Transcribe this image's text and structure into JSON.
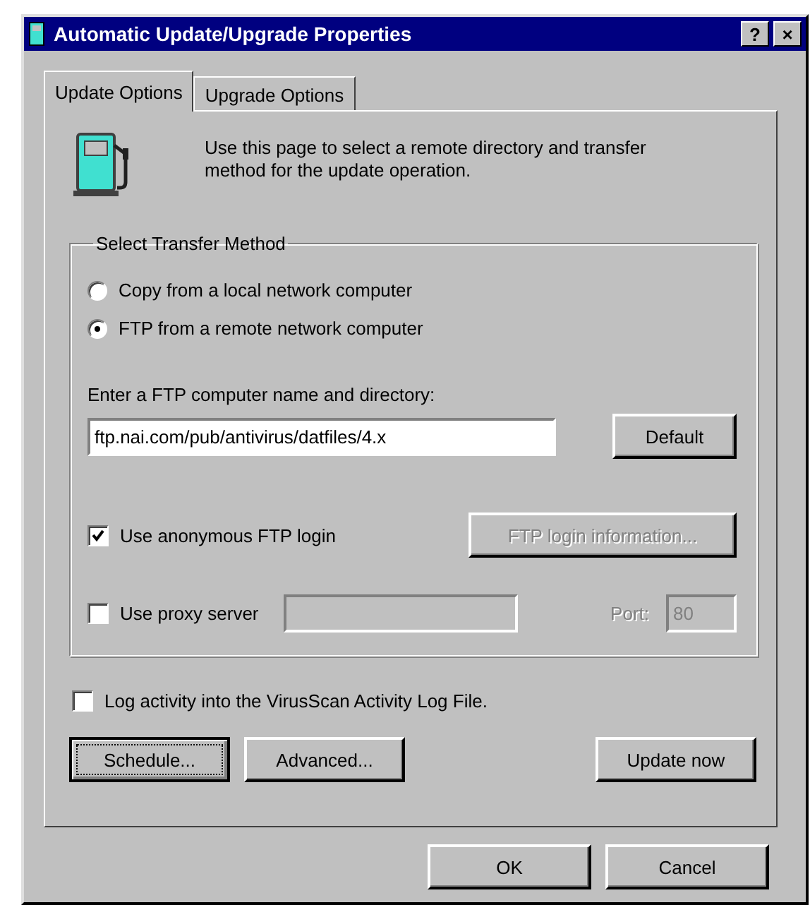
{
  "window": {
    "title": "Automatic Update/Upgrade Properties",
    "buttons": [
      "?",
      "×"
    ]
  },
  "tabs": [
    {
      "label": "Update Options",
      "selected": true
    },
    {
      "label": "Upgrade Options",
      "selected": false
    }
  ],
  "description": "Use this page to select a remote directory and transfer method for the update operation.",
  "transfer_method": {
    "title": "Select Transfer Method",
    "options": [
      {
        "label": "Copy from a local network computer",
        "selected": false
      },
      {
        "label": "FTP from a remote network computer",
        "selected": true
      }
    ],
    "ftp_label": "Enter a FTP computer name and directory:",
    "ftp_field": {
      "value": "ftp.nai.com/pub/antivirus/datfiles/4.x"
    },
    "default_button": "Default",
    "anonymous": {
      "label": "Use anonymous FTP login",
      "checked": true
    },
    "login_button": {
      "label": "FTP login information...",
      "disabled": true
    },
    "proxy": {
      "label": "Use proxy server",
      "checked": false,
      "disabled": true
    },
    "port": {
      "label": "Port:",
      "value": "80",
      "disabled": true
    }
  },
  "log_activity": {
    "label": "Log activity into the VirusScan Activity Log File.",
    "checked": false
  },
  "action_buttons": [
    {
      "label": "Schedule...",
      "focused": true
    },
    {
      "label": "Advanced...",
      "focused": false
    },
    {
      "label": "Update now",
      "focused": false
    }
  ],
  "dialog_buttons": [
    "OK",
    "Cancel"
  ]
}
